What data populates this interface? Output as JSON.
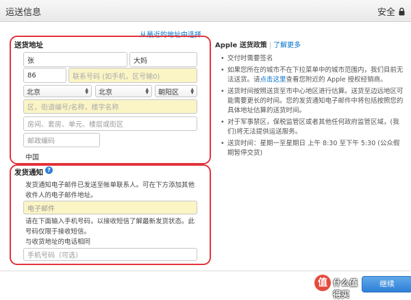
{
  "header": {
    "title": "运送信息",
    "secure_label": "安全"
  },
  "links": {
    "from_recent": "从最近的地址中选择",
    "same_as_shipping": "与收货地址的电话相同"
  },
  "shipping": {
    "section_label": "送货地址",
    "first_name": "张",
    "last_name": "大妈",
    "area_code": "86",
    "phone_placeholder": "联系号码 (如手机，区号输0)",
    "province": "北京",
    "city": "北京",
    "district": "朝阳区",
    "street_placeholder": "区，街道编号/名称，楼字名称",
    "room_placeholder": "房间、套房、单元、楼层或街区",
    "zip_placeholder": "邮政编码",
    "country": "中国"
  },
  "notification": {
    "section_label": "发货通知",
    "help_glyph": "?",
    "email_text": "发货通知电子邮件已发送至帐单联系人。可在下方添加其他收件人的电子邮件地址。",
    "email_placeholder": "电子邮件",
    "sms_text": "请在下面输入手机号码，以接收短信了解最新发货状态。此号码仅限于接收短信。",
    "mobile_placeholder": "手机号码（可选）"
  },
  "policy": {
    "title": "Apple 送货政策",
    "learn_more": "了解更多",
    "bullets": [
      "交付时需要签名",
      "如果您所在的城市不在下拉菜单中的城市范围内，我们目前无法送货。请",
      "送货时间按照送货至市中心地区进行估算。送货至边远地区可能需要更长的时间。您的发货通知电子邮件中将包括按照您的具体地址估算的送货时间。",
      "对于军事禁区，保税监管区或者其他任何政府监管区域，(我们)将无法提供运送服务。",
      "送货时间：星期一至星期日 上午 8:30 至下午 5:30 (公众假期暂停交货)"
    ],
    "bullet2_link": "点击这里",
    "bullet2_tail": "查看您附近的 Apple 授权经销商。"
  },
  "footer": {
    "continue_label": "继续",
    "badge_char": "值",
    "badge_text": "什么值得买"
  },
  "colors": {
    "highlight_border": "#e2323a",
    "link": "#0070c9",
    "required_field": "#fbf5c6",
    "button": "#2f7fd8"
  }
}
